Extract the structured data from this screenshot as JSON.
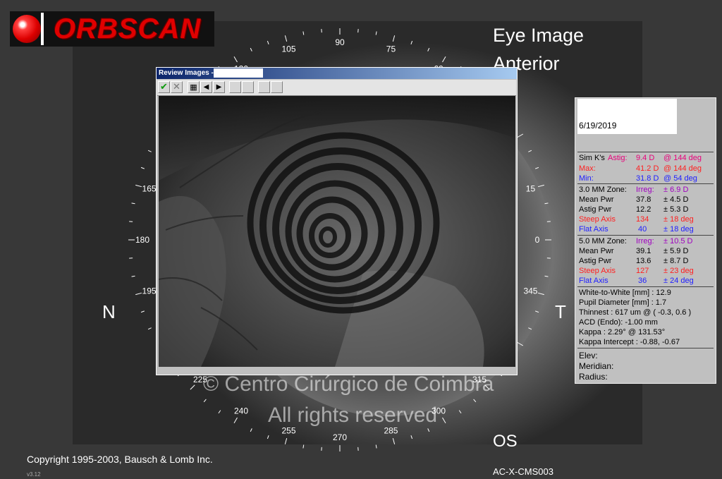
{
  "app": {
    "logo_text": "ORBSCAN"
  },
  "view": {
    "title_line1": "Eye Image",
    "title_line2": "Anterior",
    "nasal": "N",
    "temporal": "T",
    "eye": "OS",
    "device_id": "AC-X-CMS003",
    "copyright": "Copyright 1995-2003, Bausch & Lomb Inc.",
    "version": "v3.12",
    "watermark_line1": "© Centro Cirúrgico de Coimbra",
    "watermark_line2": "All rights reserved"
  },
  "protractor": {
    "labels": [
      "90",
      "75",
      "60",
      "105",
      "120",
      "165",
      "15",
      "180",
      "0",
      "195",
      "345",
      "225",
      "315",
      "240",
      "300",
      "255",
      "285",
      "270"
    ]
  },
  "review": {
    "title": "Review Images -",
    "toolbar": {
      "accept": "✔",
      "cancel": "✕",
      "save": "▦",
      "prev": "◀",
      "next": "▶"
    }
  },
  "panel": {
    "date": "6/19/2019",
    "simk": {
      "label": "Sim K's",
      "astig_label": "Astig:",
      "astig_val": "9.4 D",
      "astig_axis": "@ 144 deg",
      "max_label": "Max:",
      "max_val": "41.2 D",
      "max_axis": "@ 144 deg",
      "min_label": "Min:",
      "min_val": "31.8 D",
      "min_axis": "@ 54 deg"
    },
    "z3": {
      "label": "3.0 MM Zone:",
      "irreg_label": "Irreg:",
      "irreg_val": "± 6.9 D",
      "mean_label": "Mean Pwr",
      "mean_val": "37.8",
      "mean_sd": "± 4.5 D",
      "astig_label": "Astig Pwr",
      "astig_val": "12.2",
      "astig_sd": "± 5.3 D",
      "steep_label": "Steep Axis",
      "steep_val": "134",
      "steep_sd": "± 18 deg",
      "flat_label": "Flat Axis",
      "flat_val": "40",
      "flat_sd": "± 18 deg"
    },
    "z5": {
      "label": "5.0 MM Zone:",
      "irreg_label": "Irreg:",
      "irreg_val": "± 10.5 D",
      "mean_label": "Mean Pwr",
      "mean_val": "39.1",
      "mean_sd": "± 5.9 D",
      "astig_label": "Astig Pwr",
      "astig_val": "13.6",
      "astig_sd": "± 8.7 D",
      "steep_label": "Steep Axis",
      "steep_val": "127",
      "steep_sd": "± 23 deg",
      "flat_label": "Flat Axis",
      "flat_val": "36",
      "flat_sd": "± 24 deg"
    },
    "measures": {
      "wtw": "White-to-White [mm] : 12.9",
      "pupil": "Pupil Diameter [mm] :  1.7",
      "thinnest": "Thinnest : 617 um @ ( -0.3, 0.6 )",
      "acd": "ACD (Endo): -1.00 mm",
      "kappa": "Kappa : 2.29° @ 131.53°",
      "kappa_intercept": "Kappa Intercept : -0.88, -0.67"
    },
    "cursor": {
      "elev": "Elev:",
      "meridian": "Meridian:",
      "radius": "Radius:"
    }
  },
  "colors": {
    "title_bar": "#0a246a",
    "logo_red": "#e00000",
    "panel_bg": "#c0c0c0"
  }
}
